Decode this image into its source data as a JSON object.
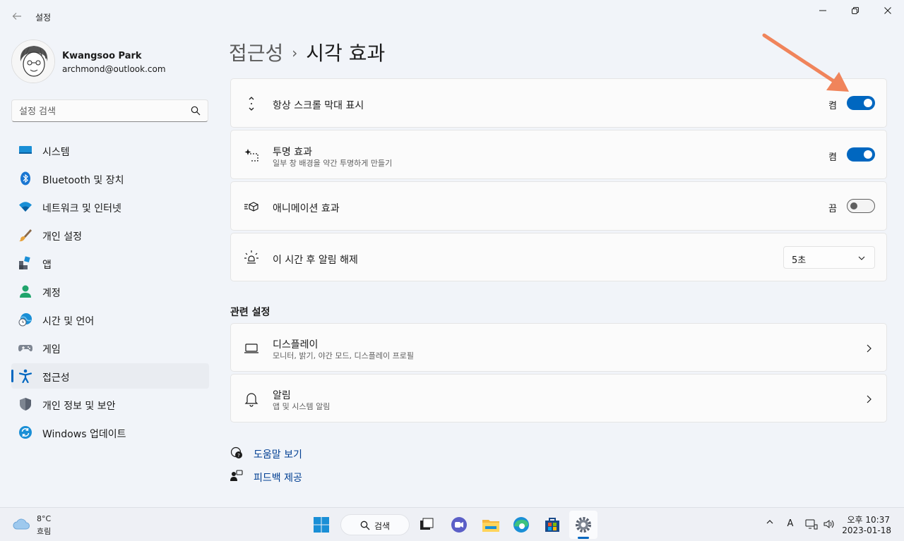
{
  "window": {
    "title": "설정",
    "minimize": "—",
    "maximize": "⧉",
    "close": "✕"
  },
  "user": {
    "name": "Kwangsoo Park",
    "email": "archmond@outlook.com"
  },
  "search": {
    "placeholder": "설정 검색"
  },
  "sidebar": {
    "items": [
      {
        "label": "시스템",
        "icon": "monitor-icon"
      },
      {
        "label": "Bluetooth 및 장치",
        "icon": "bluetooth-icon"
      },
      {
        "label": "네트워크 및 인터넷",
        "icon": "wifi-icon"
      },
      {
        "label": "개인 설정",
        "icon": "brush-icon"
      },
      {
        "label": "앱",
        "icon": "apps-icon"
      },
      {
        "label": "계정",
        "icon": "person-icon"
      },
      {
        "label": "시간 및 언어",
        "icon": "globe-clock-icon"
      },
      {
        "label": "게임",
        "icon": "gamepad-icon"
      },
      {
        "label": "접근성",
        "icon": "accessibility-icon",
        "active": true
      },
      {
        "label": "개인 정보 및 보안",
        "icon": "shield-icon"
      },
      {
        "label": "Windows 업데이트",
        "icon": "update-icon"
      }
    ]
  },
  "breadcrumb": {
    "parent": "접근성",
    "separator": "›",
    "current": "시각 효과"
  },
  "settings": {
    "scrollbars": {
      "title": "항상 스크롤 막대 표시",
      "state": "켬",
      "on": true
    },
    "transparency": {
      "title": "투명 효과",
      "subtitle": "일부 창 배경을 약간 투명하게 만들기",
      "state": "켬",
      "on": true
    },
    "animation": {
      "title": "애니메이션 효과",
      "state": "끔",
      "on": false
    },
    "notifications_timeout": {
      "title": "이 시간 후 알림 해제",
      "value": "5초"
    }
  },
  "related": {
    "title": "관련 설정",
    "display": {
      "title": "디스플레이",
      "subtitle": "모니터, 밝기, 야간 모드, 디스플레이 프로필"
    },
    "notifications": {
      "title": "알림",
      "subtitle": "앱 및 시스템 알림"
    }
  },
  "links": {
    "help": "도움말 보기",
    "feedback": "피드백 제공"
  },
  "taskbar": {
    "weather_temp": "8°C",
    "weather_cond": "흐림",
    "search_label": "검색",
    "time": "오후 10:37",
    "date": "2023-01-18",
    "ime": "A"
  },
  "colors": {
    "accent": "#0067c0",
    "annotation_arrow": "#f0845b"
  }
}
